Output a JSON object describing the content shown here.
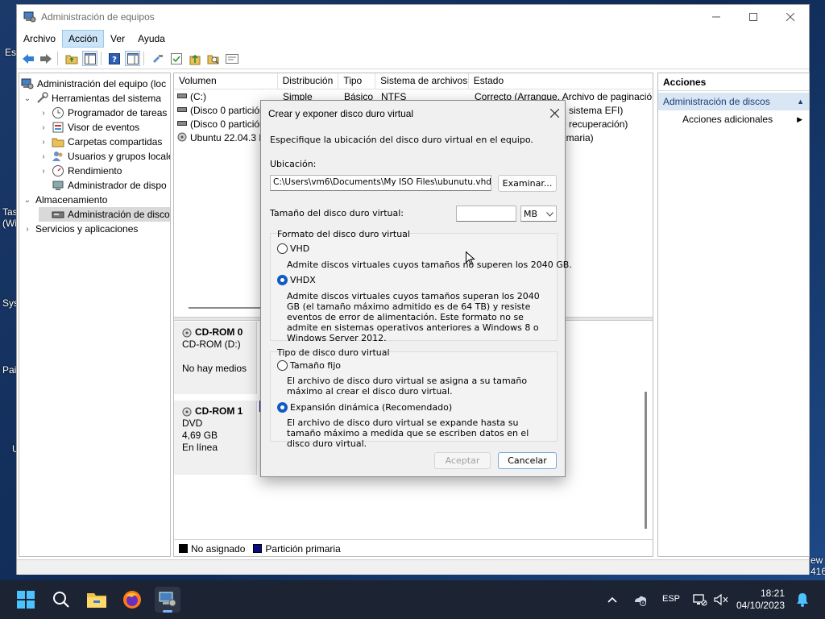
{
  "window": {
    "title": "Administración de equipos"
  },
  "menu": [
    "Archivo",
    "Acción",
    "Ver",
    "Ayuda"
  ],
  "tree": [
    {
      "label": "Administración del equipo (loc"
    },
    {
      "label": "Herramientas del sistema"
    },
    {
      "label": "Programador de tareas"
    },
    {
      "label": "Visor de eventos"
    },
    {
      "label": "Carpetas compartidas"
    },
    {
      "label": "Usuarios y grupos locale"
    },
    {
      "label": "Rendimiento"
    },
    {
      "label": "Administrador de dispo"
    },
    {
      "label": "Almacenamiento"
    },
    {
      "label": "Administración de disco"
    },
    {
      "label": "Servicios y aplicaciones"
    }
  ],
  "volumes": {
    "columns": [
      "Volumen",
      "Distribución",
      "Tipo",
      "Sistema de archivos",
      "Estado"
    ],
    "rows": [
      [
        "(C:)",
        "Simple",
        "Básico",
        "NTFS",
        "Correcto (Arranque, Archivo de paginació"
      ],
      [
        "(Disco 0 partición",
        "",
        "",
        "",
        "e sistema EFI)"
      ],
      [
        "(Disco 0 partición",
        "",
        "",
        "",
        "e recuperación)"
      ],
      [
        "Ubuntu 22.04.3 L",
        "",
        "",
        "",
        "rimaria)"
      ]
    ]
  },
  "disks": [
    {
      "name": "CD-ROM 0",
      "line1": "CD-ROM (D:)",
      "line2": "",
      "line3": "No hay medios"
    },
    {
      "name": "CD-ROM 1",
      "line1": "DVD",
      "line2": "4,69 GB",
      "line3": "En línea"
    }
  ],
  "legend": [
    {
      "label": "No asignado",
      "color": "#000000"
    },
    {
      "label": "Partición primaria",
      "color": "#0a0a82"
    }
  ],
  "actions": {
    "header": "Acciones",
    "group": "Administración de discos",
    "item": "Acciones adicionales"
  },
  "dialog": {
    "title": "Crear y exponer disco duro virtual",
    "intro": "Especifique la ubicación del disco duro virtual en el equipo.",
    "location_label": "Ubicación:",
    "location_value": "C:\\Users\\vm6\\Documents\\My ISO Files\\ubunutu.vhdx",
    "browse": "Examinar...",
    "size_label": "Tamaño del disco duro virtual:",
    "size_value": "",
    "size_unit": "MB",
    "format_group": "Formato del disco duro virtual",
    "vhd_label": "VHD",
    "vhd_desc": "Admite discos virtuales cuyos tamaños no superen los 2040 GB.",
    "vhdx_label": "VHDX",
    "vhdx_desc": "Admite discos virtuales cuyos tamaños superan los 2040 GB (el tamaño máximo admitido es de 64 TB) y resiste eventos de error de alimentación. Este formato no se admite en sistemas operativos anteriores a Windows 8 o Windows Server 2012.",
    "format_selected": "VHDX",
    "type_group": "Tipo de disco duro virtual",
    "fixed_label": "Tamaño fijo",
    "fixed_desc": "El archivo de disco duro virtual se asigna a su tamaño máximo al crear el disco duro virtual.",
    "dynamic_label": "Expansión dinámica (Recomendado)",
    "dynamic_desc": "El archivo de disco duro virtual se expande hasta su tamaño máximo a medida que se escriben datos en el disco duro virtual.",
    "type_selected": "Expansión dinámica (Recomendado)",
    "ok": "Aceptar",
    "cancel": "Cancelar"
  },
  "desktop_fragments": [
    "Es",
    "Tas",
    "(Wi",
    "Sys",
    "Pai",
    "U",
    "ew",
    "416"
  ],
  "taskbar": {
    "lang": "ESP",
    "time": "18:21",
    "date": "04/10/2023"
  }
}
